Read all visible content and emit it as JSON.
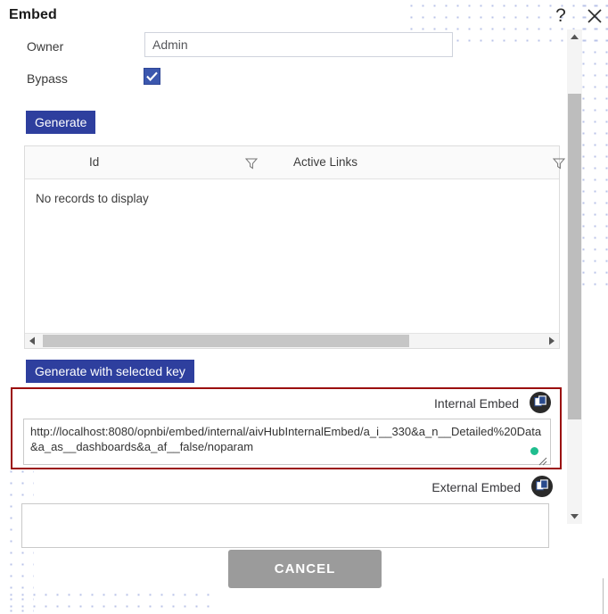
{
  "dialog": {
    "title": "Embed",
    "help_icon": "?",
    "close_icon": "close-icon"
  },
  "form": {
    "owner": {
      "label": "Owner",
      "value": "Admin",
      "placeholder": ""
    },
    "bypass": {
      "label": "Bypass",
      "checked": true
    },
    "generate_button": "Generate",
    "generate_with_selected_key_button": "Generate with selected key"
  },
  "grid": {
    "columns": [
      {
        "header": "Id",
        "filter_icon": "filter-icon"
      },
      {
        "header": "Active Links",
        "filter_icon": "filter-icon"
      }
    ],
    "empty_message": "No records to display"
  },
  "internal_embed": {
    "label": "Internal Embed",
    "copy_icon": "copy-icon",
    "value": "http://localhost:8080/opnbi/embed/internal/aivHubInternalEmbed/a_i__330&a_n__Detailed%20Data&a_as__dashboards&a_af__false/noparam",
    "status_dot_color": "#1fbd8e",
    "highlight_color": "#9b0d0d"
  },
  "external_embed": {
    "label": "External Embed",
    "copy_icon": "copy-icon",
    "value": ""
  },
  "footer": {
    "cancel_button": "CANCEL"
  },
  "colors": {
    "primary_blue": "#2e3f9e",
    "checkbox_blue": "#3b57ae",
    "cancel_gray": "#9b9b9b",
    "dot_pattern": "#b9c3e8"
  }
}
